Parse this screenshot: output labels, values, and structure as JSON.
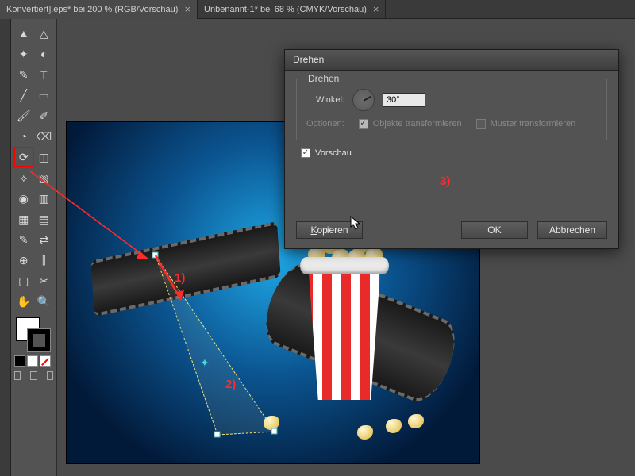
{
  "tabs": [
    {
      "label": "Konvertiert].eps* bei 200 % (RGB/Vorschau)",
      "active": true
    },
    {
      "label": "Unbenannt-1* bei 68 % (CMYK/Vorschau)",
      "active": false
    }
  ],
  "dialog": {
    "title": "Drehen",
    "fieldset_legend": "Drehen",
    "angle_label": "Winkel:",
    "angle_value": "30°",
    "options_label": "Optionen:",
    "opt_objects": "Objekte transformieren",
    "opt_pattern": "Muster transformieren",
    "preview_label": "Vorschau",
    "btn_copy": "Kopieren",
    "btn_ok": "OK",
    "btn_cancel": "Abbrechen"
  },
  "annotations": {
    "a1": "1)",
    "a2": "2)",
    "a3": "3)"
  },
  "tools": [
    [
      "selection",
      "direct-selection"
    ],
    [
      "magic-wand",
      "lasso"
    ],
    [
      "pen",
      "type"
    ],
    [
      "line",
      "rectangle"
    ],
    [
      "brush",
      "pencil"
    ],
    [
      "blob",
      "eraser"
    ],
    [
      "rotate",
      "scale"
    ],
    [
      "width",
      "free-transform"
    ],
    [
      "shape-builder",
      "perspective"
    ],
    [
      "mesh",
      "gradient"
    ],
    [
      "eyedropper",
      "blend"
    ],
    [
      "symbol",
      "graph"
    ],
    [
      "artboard",
      "slice"
    ],
    [
      "hand",
      "zoom"
    ]
  ],
  "tool_glyphs": {
    "selection": "▲",
    "direct-selection": "△",
    "magic-wand": "✦",
    "lasso": "◐",
    "pen": "✎",
    "type": "T",
    "line": "╱",
    "rectangle": "▭",
    "brush": "🖌",
    "pencil": "✐",
    "blob": "◔",
    "eraser": "⌫",
    "rotate": "⟳",
    "scale": "◫",
    "width": "⟡",
    "free-transform": "▧",
    "shape-builder": "◉",
    "perspective": "▥",
    "mesh": "▦",
    "gradient": "▤",
    "eyedropper": "✎",
    "blend": "⇄",
    "symbol": "⊕",
    "graph": "⫿",
    "artboard": "▢",
    "slice": "✂",
    "hand": "✋",
    "zoom": "🔍"
  }
}
